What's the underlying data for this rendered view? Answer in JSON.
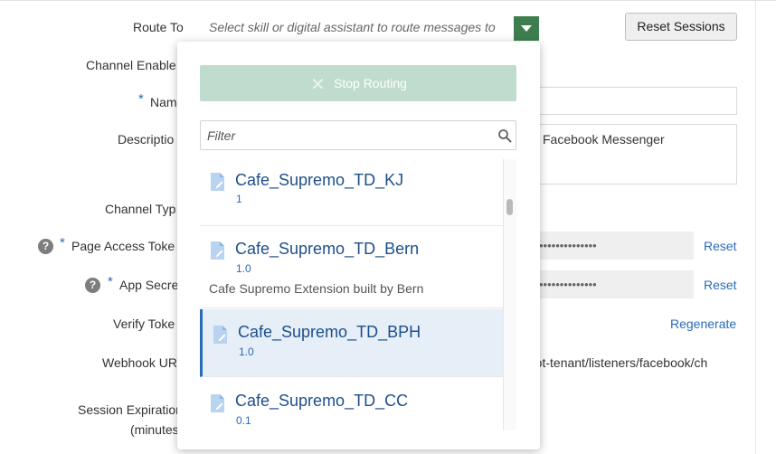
{
  "form": {
    "route_to_label": "Route To",
    "route_to_placeholder": "Select skill or digital assistant to route messages to",
    "reset_sessions": "Reset Sessions",
    "channel_enabled_label": "Channel Enable",
    "name_label": "Nam",
    "description_label": "Descriptio",
    "description_value": "Facebook Messenger",
    "channel_type_label": "Channel Typ",
    "page_access_token_label": "Page Access Toke",
    "page_access_token_value": "••••••••••••••",
    "page_access_token_reset": "Reset",
    "app_secret_label": "App Secre",
    "app_secret_value": "••••••••••••••",
    "app_secret_reset": "Reset",
    "verify_token_label": "Verify Toke",
    "verify_token_regenerate": "Regenerate",
    "webhook_url_label": "Webhook UR",
    "webhook_url_value": "tbot-tenant/listeners/facebook/ch",
    "session_expiration_label": "Session Expiration",
    "session_expiration_unit": "(minutes",
    "required_marker": "*",
    "help_marker": "?"
  },
  "dropdown": {
    "stop_routing": "Stop Routing",
    "filter_placeholder": "Filter",
    "items": [
      {
        "name": "Cafe_Supremo_TD_KJ",
        "version": "1",
        "description": ""
      },
      {
        "name": "Cafe_Supremo_TD_Bern",
        "version": "1.0",
        "description": "Cafe Supremo Extension built by Bern"
      },
      {
        "name": "Cafe_Supremo_TD_BPH",
        "version": "1.0",
        "description": "",
        "selected": true
      },
      {
        "name": "Cafe_Supremo_TD_CC",
        "version": "0.1",
        "description": ""
      }
    ]
  },
  "colors": {
    "accent": "#2a6bb8",
    "dropdown_button": "#3d7d4e",
    "stop_routing_bg": "#c0dcce",
    "selected_bg": "#e6eef8"
  },
  "icons": {
    "dropdown": "chevron-down-icon",
    "search": "search-icon",
    "document": "document-icon",
    "close": "close-icon",
    "help": "help-icon"
  }
}
